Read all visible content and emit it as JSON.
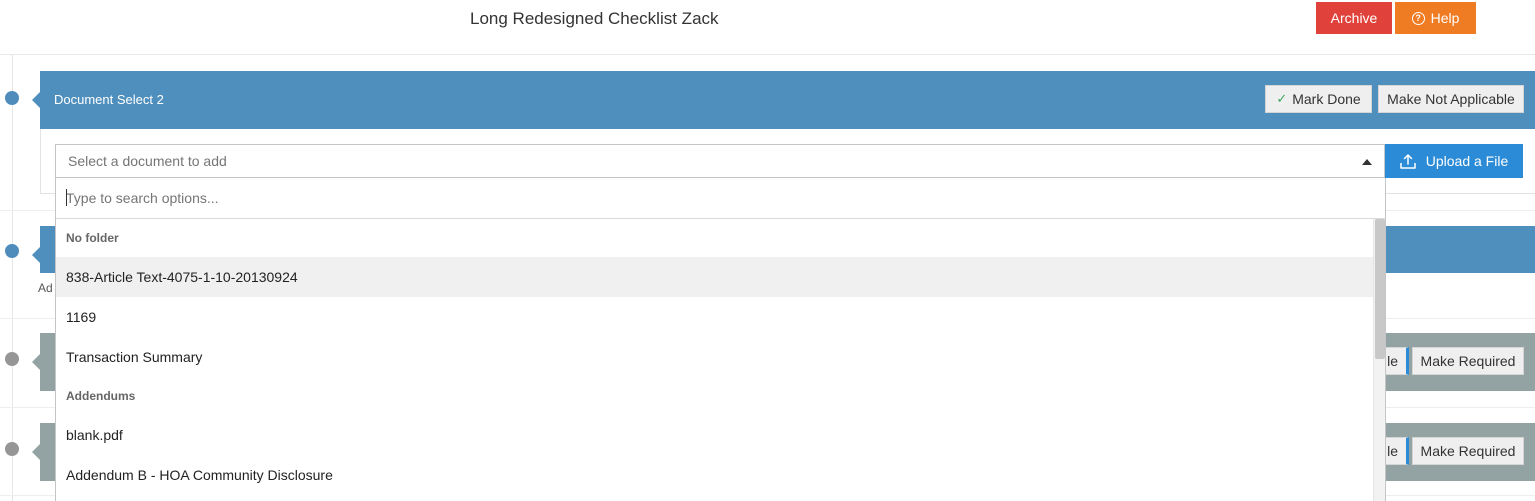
{
  "header": {
    "title": "Long Redesigned Checklist Zack",
    "archive_label": "Archive",
    "help_label": "Help"
  },
  "task": {
    "title": "Document Select 2",
    "mark_done_label": "Mark Done",
    "not_applicable_label": "Make Not Applicable"
  },
  "document_select": {
    "placeholder": "Select a document to add",
    "upload_label": "Upload a File"
  },
  "background": {
    "partial_text": "Ad",
    "truncated_button_label": "le",
    "make_required_label": "Make Required"
  },
  "dropdown": {
    "search_placeholder": "Type to search options...",
    "groups": [
      {
        "label": "No folder",
        "options": [
          "838-Article Text-4075-1-10-20130924",
          "1169",
          "Transaction Summary"
        ]
      },
      {
        "label": "Addendums",
        "options": [
          "blank.pdf",
          "Addendum B - HOA Community Disclosure"
        ]
      }
    ],
    "highlighted": "838-Article Text-4075-1-10-20130924"
  },
  "colors": {
    "task_blue": "#4f8fbd",
    "task_gray": "#93a3a3",
    "archive": "#e0413a",
    "help": "#ef7b23",
    "upload": "#2b8bd6"
  }
}
